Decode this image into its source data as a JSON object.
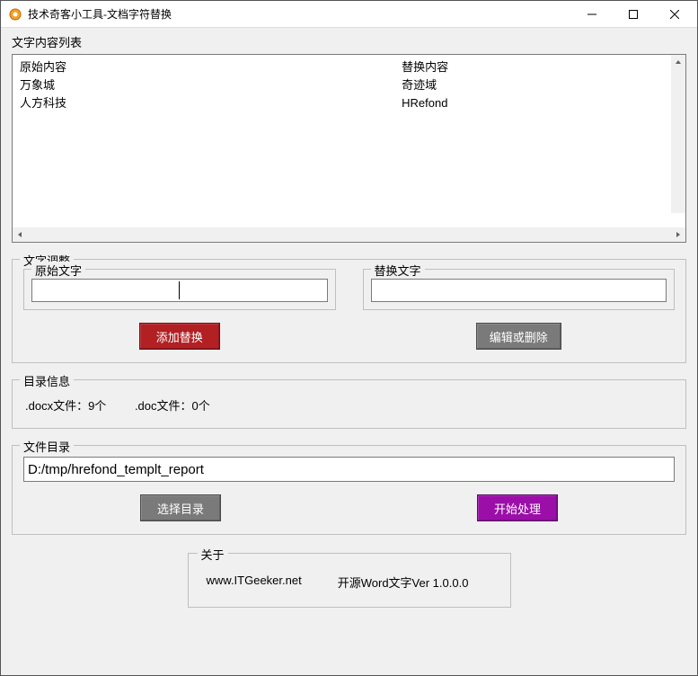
{
  "window": {
    "title": "技术奇客小工具-文档字符替换"
  },
  "sections": {
    "list_label": "文字内容列表",
    "adjust_label": "文字调整",
    "original_label": "原始文字",
    "replace_label": "替换文字",
    "dir_info_label": "目录信息",
    "file_dir_label": "文件目录",
    "about_label": "关于"
  },
  "list": {
    "header_left": "原始内容",
    "header_right": "替换内容",
    "rows": [
      {
        "left": "万象城",
        "right": "奇迹域"
      },
      {
        "left": "人方科技",
        "right": "HRefond"
      }
    ]
  },
  "inputs": {
    "original_value": "",
    "replace_value": "",
    "path_value": "D:/tmp/hrefond_templt_report"
  },
  "buttons": {
    "add": "添加替换",
    "edit_delete": "编辑或删除",
    "choose_dir": "选择目录",
    "start": "开始处理"
  },
  "dir_info": {
    "docx": ".docx文件：9个",
    "doc": ".doc文件：0个"
  },
  "about": {
    "site": "www.ITGeeker.net",
    "version": "开源Word文字Ver 1.0.0.0"
  }
}
